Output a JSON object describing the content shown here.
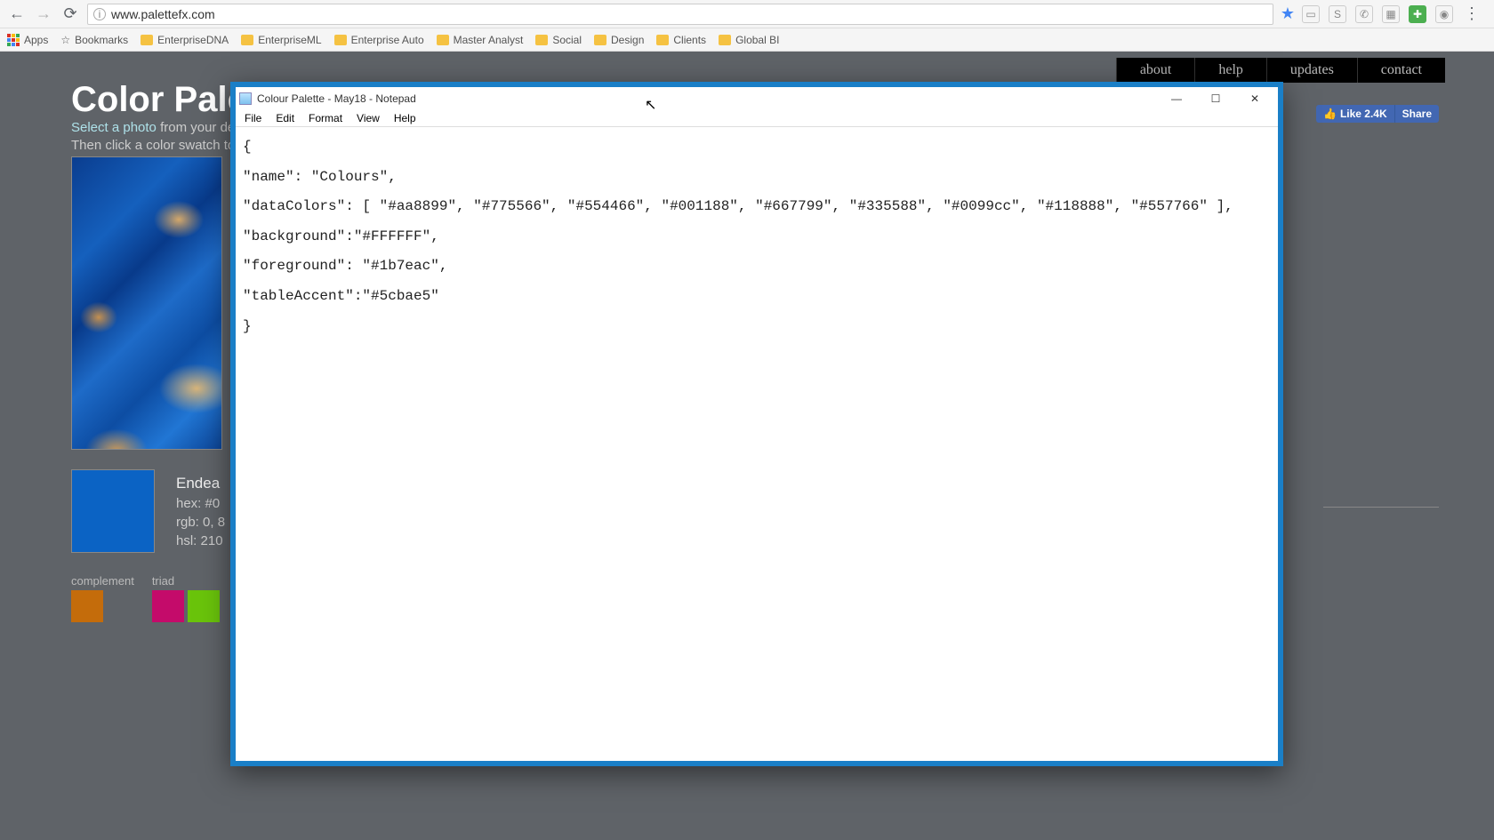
{
  "browser": {
    "url": "www.palettefx.com",
    "bookmarks": {
      "apps": "Apps",
      "bookmarks": "Bookmarks",
      "items": [
        "EnterpriseDNA",
        "EnterpriseML",
        "Enterprise Auto",
        "Master Analyst",
        "Social",
        "Design",
        "Clients",
        "Global BI"
      ]
    }
  },
  "page": {
    "title": "Color Palette",
    "sub_highlight": "Select a photo",
    "sub_rest1": " from your de",
    "sub_line2": "Then click a color swatch to",
    "nav": [
      "about",
      "help",
      "updates",
      "contact"
    ],
    "fb_like": "Like 2.4K",
    "fb_share": "Share",
    "swatch": {
      "name": "Endea",
      "hex": "hex: #0",
      "rgb": "rgb: 0, 8",
      "hsl": "hsl: 210"
    },
    "harmony": {
      "complement": "complement",
      "triad": "triad"
    }
  },
  "notepad": {
    "title": "Colour Palette - May18 - Notepad",
    "menu": [
      "File",
      "Edit",
      "Format",
      "View",
      "Help"
    ],
    "content": "{\n\"name\": \"Colours\",\n\"dataColors\": [ \"#aa8899\", \"#775566\", \"#554466\", \"#001188\", \"#667799\", \"#335588\", \"#0099cc\", \"#118888\", \"#557766\" ],\n\"background\":\"#FFFFFF\",\n\"foreground\": \"#1b7eac\",\n\"tableAccent\":\"#5cbae5\"\n}"
  },
  "colors": {
    "big_swatch": "#0b63c4",
    "complement": "#c46c0b",
    "triad1": "#c40b6a",
    "triad2": "#6ac40b"
  }
}
